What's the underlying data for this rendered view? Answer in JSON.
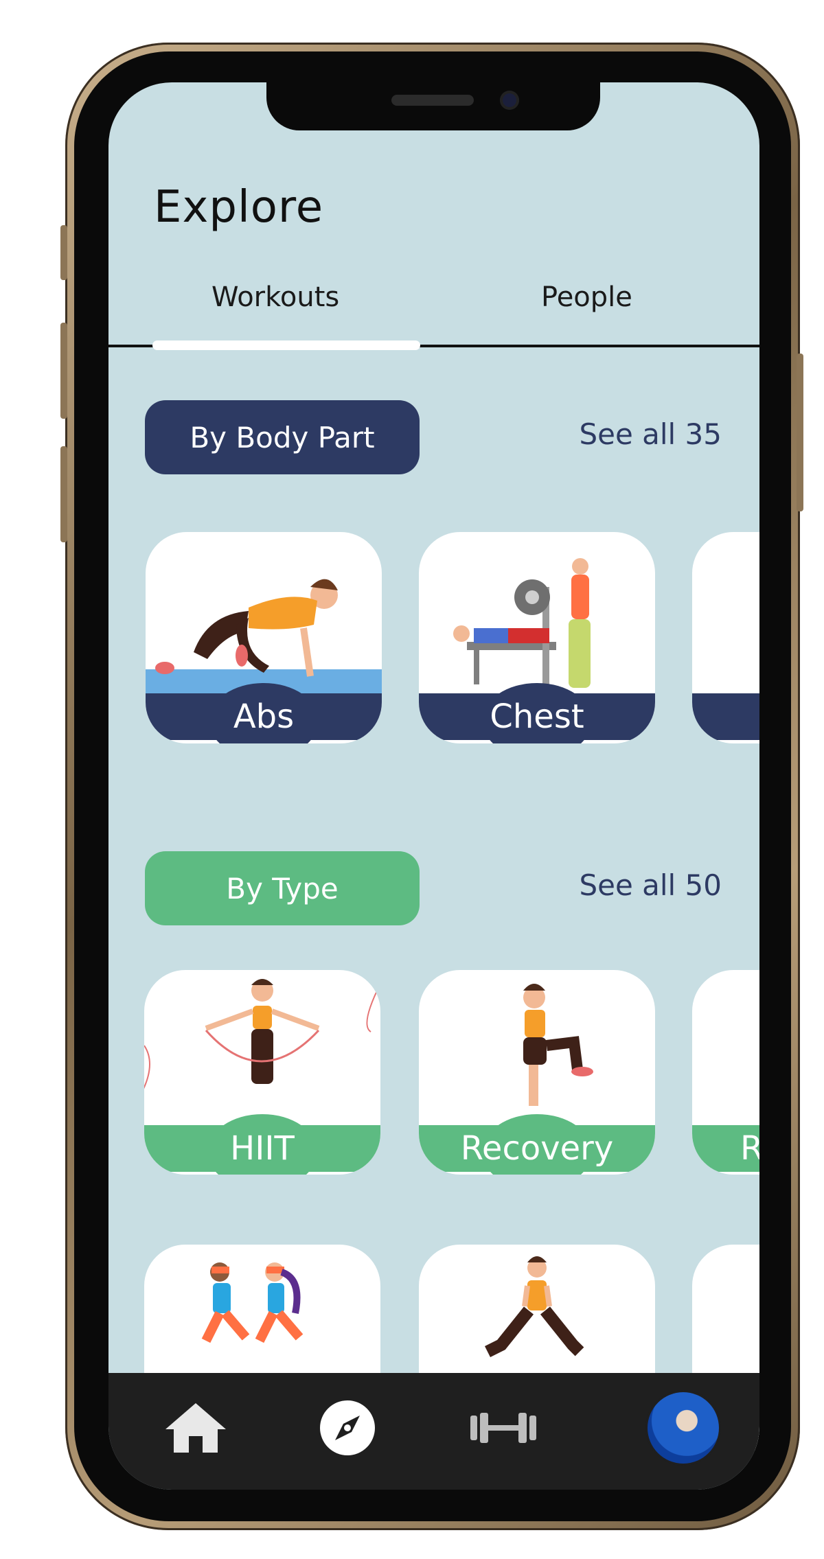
{
  "page": {
    "title": "Explore"
  },
  "tabs": [
    {
      "label": "Workouts",
      "active": true
    },
    {
      "label": "People",
      "active": false
    }
  ],
  "sections": {
    "body_part": {
      "label": "By Body Part",
      "see_all": "See all 35",
      "items": [
        {
          "label": "Abs"
        },
        {
          "label": "Chest"
        },
        {
          "label": ""
        }
      ]
    },
    "type": {
      "label": "By Type",
      "see_all": "See all 50",
      "items": [
        {
          "label": "HIIT"
        },
        {
          "label": "Recovery"
        },
        {
          "label": "R"
        }
      ]
    }
  },
  "bottom_nav": [
    {
      "name": "home-icon"
    },
    {
      "name": "compass-icon"
    },
    {
      "name": "dumbbell-icon"
    },
    {
      "name": "profile-avatar"
    }
  ],
  "colors": {
    "background": "#c8dee3",
    "navy": "#2d3a63",
    "green": "#5dbb82",
    "nav_bar": "#1f1f1f"
  }
}
